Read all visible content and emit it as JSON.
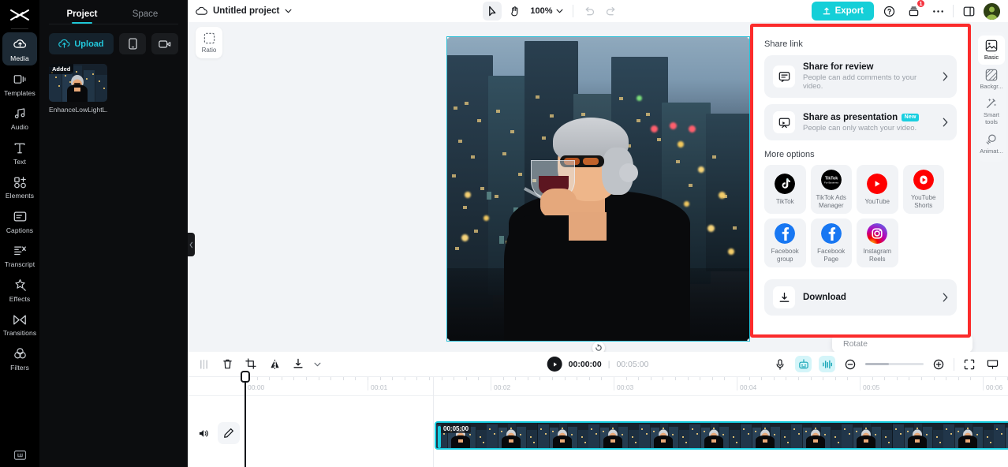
{
  "app": {
    "name": "video-editor",
    "accent": "#15cfd8",
    "highlight_outline_color": "#fb2b2b"
  },
  "left_rail": {
    "logo_icon": "scissors-logo-icon",
    "items": [
      {
        "label": "Media",
        "icon": "media-icon",
        "active": true
      },
      {
        "label": "Templates",
        "icon": "templates-icon",
        "active": false
      },
      {
        "label": "Audio",
        "icon": "audio-icon",
        "active": false
      },
      {
        "label": "Text",
        "icon": "text-icon",
        "active": false
      },
      {
        "label": "Elements",
        "icon": "elements-icon",
        "active": false
      },
      {
        "label": "Captions",
        "icon": "captions-icon",
        "active": false
      },
      {
        "label": "Transcript",
        "icon": "transcript-icon",
        "active": false
      },
      {
        "label": "Effects",
        "icon": "effects-icon",
        "active": false
      },
      {
        "label": "Transitions",
        "icon": "transitions-icon",
        "active": false
      },
      {
        "label": "Filters",
        "icon": "filters-icon",
        "active": false
      }
    ],
    "bottom_icon": "keyboard-shortcuts-icon"
  },
  "project_panel": {
    "tabs": [
      {
        "label": "Project",
        "active": true
      },
      {
        "label": "Space",
        "active": false
      }
    ],
    "upload_label": "Upload",
    "upload_icon": "cloud-upload-icon",
    "device_button_icon": "phone-icon",
    "record_button_icon": "camera-icon",
    "media": [
      {
        "name": "EnhanceLowLightL...",
        "badge": "Added"
      }
    ],
    "collapse_icon": "chevron-left-icon"
  },
  "topbar": {
    "cloud_icon": "cloud-sync-icon",
    "project_title": "Untitled project",
    "title_dropdown_icon": "chevron-down-icon",
    "select_tool_icon": "cursor-arrow-icon",
    "hand_tool_icon": "hand-icon",
    "zoom_level": "100%",
    "zoom_dropdown_icon": "chevron-down-icon",
    "undo_icon": "undo-icon",
    "redo_icon": "redo-icon",
    "export_label": "Export",
    "export_icon": "export-upload-icon",
    "help_icon": "help-circle-icon",
    "notifications_icon": "inbox-icon",
    "notifications_count": "1",
    "more_icon": "more-horizontal-icon",
    "layout_icon": "panel-layout-icon",
    "avatar_icon": "user-avatar"
  },
  "stage": {
    "ratio_label": "Ratio",
    "ratio_icon": "crop-ratio-icon",
    "rotate_tooltip": "Rotate",
    "rotate_handle_icon": "rotate-icon"
  },
  "share_panel": {
    "share_link_title": "Share link",
    "rows": [
      {
        "title": "Share for review",
        "subtitle": "People can add comments to your video.",
        "icon": "comment-bubble-icon",
        "badge": ""
      },
      {
        "title": "Share as presentation",
        "subtitle": "People can only watch your video.",
        "icon": "presentation-icon",
        "badge": "New"
      }
    ],
    "more_options_title": "More options",
    "tiles": [
      {
        "label": "TikTok",
        "icon": "tiktok-icon"
      },
      {
        "label": "TikTok Ads\nManager",
        "icon": "tiktok-ads-manager-icon"
      },
      {
        "label": "YouTube",
        "icon": "youtube-icon"
      },
      {
        "label": "YouTube\nShorts",
        "icon": "youtube-shorts-icon"
      },
      {
        "label": "Facebook\ngroup",
        "icon": "facebook-icon"
      },
      {
        "label": "Facebook\nPage",
        "icon": "facebook-icon"
      },
      {
        "label": "Instagram\nReels",
        "icon": "instagram-icon"
      }
    ],
    "download_label": "Download",
    "download_icon": "download-icon",
    "chevron_icon": "chevron-right-icon"
  },
  "right_rail": {
    "items": [
      {
        "label": "Basic",
        "icon": "image-basic-icon",
        "active": true
      },
      {
        "label": "Backgr...",
        "icon": "background-icon",
        "active": false
      },
      {
        "label": "Smart\ntools",
        "icon": "magic-wand-icon",
        "active": false
      },
      {
        "label": "Animat...",
        "icon": "animation-icon",
        "active": false
      }
    ]
  },
  "timeline": {
    "tools": [
      {
        "icon": "split-icon",
        "label": "Split"
      },
      {
        "icon": "delete-icon",
        "label": "Delete"
      },
      {
        "icon": "crop-icon",
        "label": "Crop"
      },
      {
        "icon": "mirror-icon",
        "label": "Mirror"
      },
      {
        "icon": "download-icon",
        "label": "Download"
      },
      {
        "icon": "chevron-down-icon",
        "label": "More"
      }
    ],
    "play_icon": "play-icon",
    "current_time": "00:00:00",
    "time_separator": "|",
    "total_time": "00:05:00",
    "right_tools": [
      {
        "icon": "microphone-icon",
        "label": "Voiceover",
        "on": false
      },
      {
        "icon": "auto-adjust-icon",
        "label": "Auto adjust",
        "on": true
      },
      {
        "icon": "waveform-icon",
        "label": "Audio waves",
        "on": true
      }
    ],
    "zoom_out_icon": "zoom-out-icon",
    "zoom_in_icon": "zoom-in-icon",
    "fit_icon": "fit-screen-icon",
    "fullscreen_icon": "present-icon",
    "ruler_labels": [
      "00:00",
      "00:01",
      "00:02",
      "00:03",
      "00:04",
      "00:05",
      "00:06"
    ],
    "mute_icon": "volume-icon",
    "edit_icon": "pencil-icon",
    "clip": {
      "duration_label": "00:05:00",
      "selected": true
    }
  }
}
